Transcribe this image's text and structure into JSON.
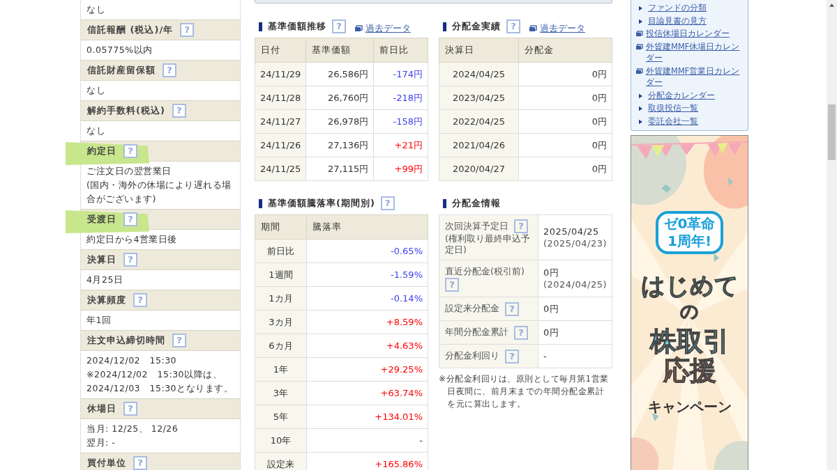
{
  "fund_details": [
    {
      "value_lines": [
        "なし"
      ]
    },
    {
      "label": "信託報酬 (税込)/年",
      "help": "?",
      "value_lines": [
        "0.05775%以内"
      ]
    },
    {
      "label": "信託財産留保額",
      "help": "?",
      "value_lines": [
        "なし"
      ]
    },
    {
      "label": "解約手数料(税込)",
      "help": "?",
      "value_lines": [
        "なし"
      ]
    },
    {
      "label": "約定日",
      "help": "?",
      "highlighted": true,
      "value_lines": [
        "ご注文日の翌営業日",
        "(国内・海外の休場により遅れる場合がございます)"
      ]
    },
    {
      "label": "受渡日",
      "help": "?",
      "highlighted": true,
      "value_lines": [
        "約定日から4営業日後"
      ]
    },
    {
      "label": "決算日",
      "help": "?",
      "value_lines": [
        "4月25日"
      ]
    },
    {
      "label": "決算頻度",
      "help": "?",
      "value_lines": [
        "年1回"
      ]
    },
    {
      "label": "注文申込締切時間",
      "help": "?",
      "value_lines": [
        "2024/12/02　15:30",
        "※2024/12/02　15:30以降は、",
        "2024/12/03　15:30となります。"
      ]
    },
    {
      "label": "休場日",
      "help": "?",
      "value_lines": [
        "当月: 12/25、 12/26",
        "翌月: -"
      ]
    },
    {
      "label": "買付単位",
      "help": "?"
    }
  ],
  "nav_history": {
    "title": "基準価額推移",
    "help": "?",
    "link": "過去データ",
    "columns": [
      "日付",
      "基準価額",
      "前日比"
    ],
    "rows": [
      {
        "date": "24/11/29",
        "price": "26,586円",
        "change": "-174円",
        "kind": "down"
      },
      {
        "date": "24/11/28",
        "price": "26,760円",
        "change": "-218円",
        "kind": "down"
      },
      {
        "date": "24/11/27",
        "price": "26,978円",
        "change": "-158円",
        "kind": "down"
      },
      {
        "date": "24/11/26",
        "price": "27,136円",
        "change": "+21円",
        "kind": "up"
      },
      {
        "date": "24/11/25",
        "price": "27,115円",
        "change": "+99円",
        "kind": "up"
      }
    ]
  },
  "distribution_history": {
    "title": "分配金実績",
    "help": "?",
    "link": "過去データ",
    "columns": [
      "決算日",
      "分配金"
    ],
    "rows": [
      {
        "date": "2024/04/25",
        "amount": "0円"
      },
      {
        "date": "2023/04/25",
        "amount": "0円"
      },
      {
        "date": "2022/04/25",
        "amount": "0円"
      },
      {
        "date": "2021/04/26",
        "amount": "0円"
      },
      {
        "date": "2020/04/27",
        "amount": "0円"
      }
    ]
  },
  "returns": {
    "title": "基準価額騰落率(期間別)",
    "help": "?",
    "columns": [
      "期間",
      "騰落率"
    ],
    "rows": [
      {
        "period": "前日比",
        "rate": "-0.65%",
        "kind": "down"
      },
      {
        "period": "1週間",
        "rate": "-1.59%",
        "kind": "down"
      },
      {
        "period": "1カ月",
        "rate": "-0.14%",
        "kind": "down"
      },
      {
        "period": "3カ月",
        "rate": "+8.59%",
        "kind": "up"
      },
      {
        "period": "6カ月",
        "rate": "+4.63%",
        "kind": "up"
      },
      {
        "period": "1年",
        "rate": "+29.25%",
        "kind": "up"
      },
      {
        "period": "3年",
        "rate": "+63.74%",
        "kind": "up"
      },
      {
        "period": "5年",
        "rate": "+134.01%",
        "kind": "up"
      },
      {
        "period": "10年",
        "rate": "-",
        "kind": "none"
      },
      {
        "period": "設定来",
        "rate": "+165.86%",
        "kind": "up"
      }
    ]
  },
  "distribution_info": {
    "title": "分配金情報",
    "rows": [
      {
        "label": "次回決算予定日",
        "help": "?",
        "sublabel": "(権利取り最終申込予定日)",
        "value_lines": [
          "2025/04/25",
          "(2025/04/23)"
        ]
      },
      {
        "label": "直近分配金(税引前)",
        "help": "?",
        "value_lines": [
          "0円",
          "(2024/04/25)"
        ]
      },
      {
        "label": "設定来分配金",
        "help": "?",
        "value_lines": [
          "0円"
        ]
      },
      {
        "label": "年間分配金累計",
        "help": "?",
        "value_lines": [
          "0円"
        ]
      },
      {
        "label": "分配金利回り",
        "help": "?",
        "value_lines": [
          "-"
        ]
      }
    ],
    "note": "※分配金利回りは、原則として毎月第1営業日夜間に、前月末までの年間分配金累計を元に算出します。"
  },
  "sidebar_links": [
    {
      "label": "ファンドの分類",
      "kind": "page"
    },
    {
      "label": "目論見書の見方",
      "kind": "page"
    },
    {
      "label": "投信休場日カレンダー",
      "kind": "popup"
    },
    {
      "label": "外貨建MMF休場日カレンダー",
      "kind": "popup"
    },
    {
      "label": "外貨建MMF営業日カレンダー",
      "kind": "popup"
    },
    {
      "label": "分配金カレンダー",
      "kind": "page"
    },
    {
      "label": "取扱投信一覧",
      "kind": "page"
    },
    {
      "label": "委託会社一覧",
      "kind": "page"
    }
  ],
  "banner": {
    "badge_lines": [
      "ゼ0革命",
      "1周年!"
    ],
    "headline": "はじめて",
    "particle": "の",
    "subject": "株取引",
    "support": "応援",
    "campaign": "キャンペーン"
  }
}
